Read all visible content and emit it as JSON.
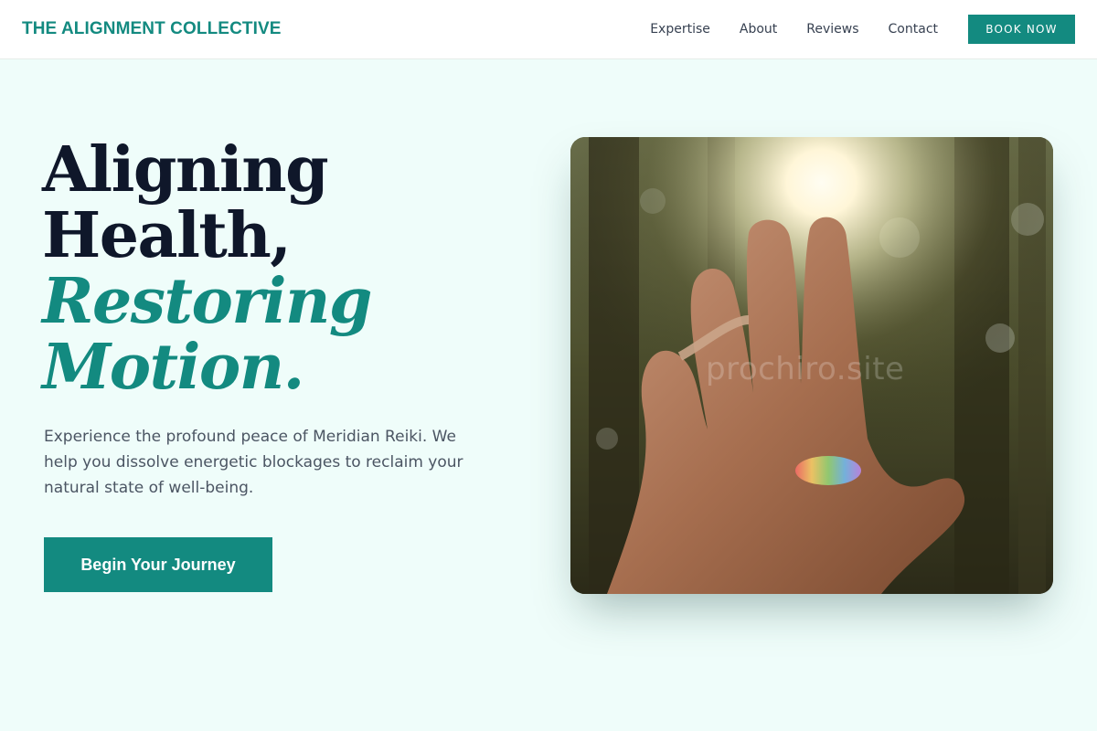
{
  "header": {
    "brand": "THE ALIGNMENT COLLECTIVE",
    "nav": [
      "Expertise",
      "About",
      "Reviews",
      "Contact"
    ],
    "book_label": "BOOK NOW"
  },
  "hero": {
    "title_lines": [
      "Aligning",
      "Health,"
    ],
    "accent_lines": [
      "Restoring",
      "Motion."
    ],
    "description": "Experience the profound peace of Meridian Reiki. We help you dissolve energetic blockages to reclaim your natural state of well-being.",
    "cta_label": "Begin Your Journey",
    "image_watermark": "prochiro.site"
  },
  "colors": {
    "accent": "#138a80",
    "heading": "#0f172a",
    "background": "#effdfa"
  }
}
